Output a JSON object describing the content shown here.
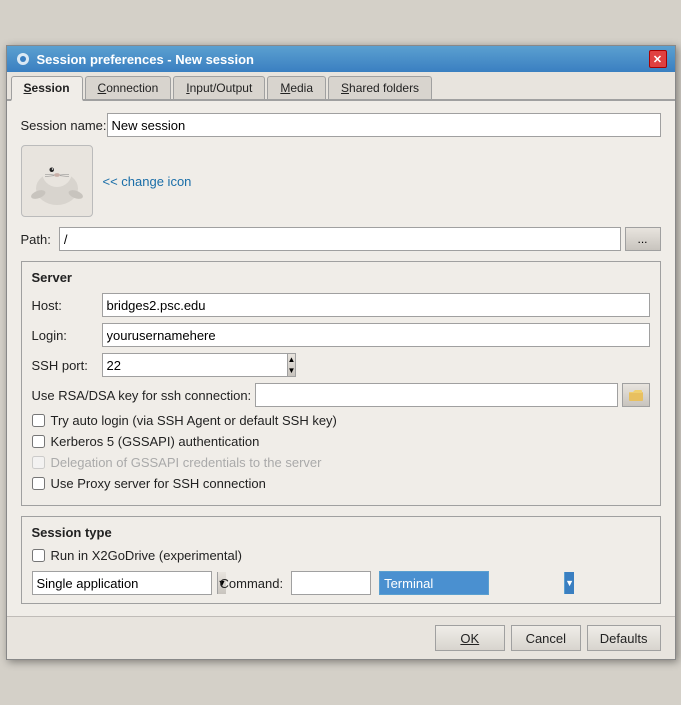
{
  "window": {
    "title": "Session preferences - New session"
  },
  "tabs": [
    {
      "label": "Session",
      "underline": "S",
      "active": true
    },
    {
      "label": "Connection",
      "underline": "C",
      "active": false
    },
    {
      "label": "Input/Output",
      "underline": "I",
      "active": false
    },
    {
      "label": "Media",
      "underline": "M",
      "active": false
    },
    {
      "label": "Shared folders",
      "underline": "S",
      "active": false
    }
  ],
  "session": {
    "name_label": "Session name:",
    "name_value": "New session",
    "change_icon_text": "<< change icon",
    "path_label": "Path:",
    "path_value": "/",
    "browse_label": "..."
  },
  "server": {
    "group_label": "Server",
    "host_label": "Host:",
    "host_value": "bridges2.psc.edu",
    "login_label": "Login:",
    "login_value": "yourusernamehere",
    "ssh_port_label": "SSH port:",
    "ssh_port_value": "22",
    "rsa_label": "Use RSA/DSA key for ssh connection:",
    "rsa_value": "",
    "try_autologin_label": "Try auto login (via SSH Agent or default SSH key)",
    "kerberos_label": "Kerberos 5 (GSSAPI) authentication",
    "delegation_label": "Delegation of GSSAPI credentials to the server",
    "proxy_label": "Use Proxy server for SSH connection"
  },
  "session_type": {
    "group_label": "Session type",
    "run_x2go_label": "Run in X2GoDrive (experimental)",
    "dropdown_value": "Single application",
    "command_label": "Command:",
    "command_value": "",
    "terminal_label": "Terminal"
  },
  "buttons": {
    "ok": "OK",
    "cancel": "Cancel",
    "defaults": "Defaults"
  },
  "icons": {
    "close": "✕",
    "spin_up": "▲",
    "spin_down": "▼",
    "dropdown_arrow": "▼",
    "file_icon": "📂"
  }
}
